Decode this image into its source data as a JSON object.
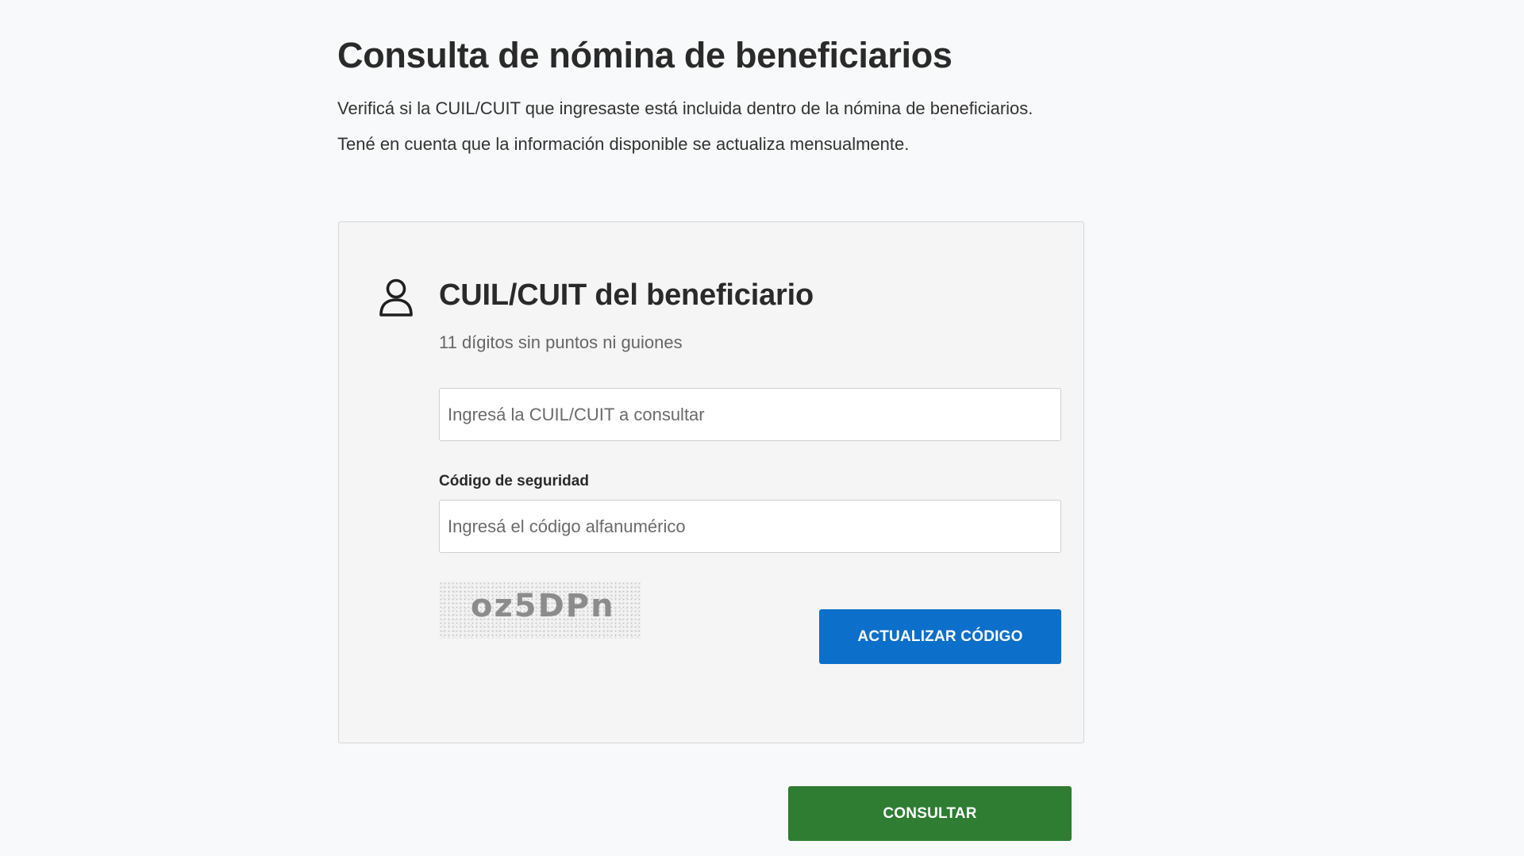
{
  "page": {
    "title": "Consulta de nómina de beneficiarios",
    "intro_line_1": "Verificá si la CUIL/CUIT que ingresaste está incluida dentro de la nómina de beneficiarios.",
    "intro_line_2": "Tené en cuenta que la información disponible se actualiza mensualmente."
  },
  "form": {
    "icon": "user-icon",
    "title": "CUIL/CUIT del beneficiario",
    "hint": "11 dígitos sin puntos ni guiones",
    "cuil_input": {
      "value": "",
      "placeholder": "Ingresá la CUIL/CUIT a consultar"
    },
    "security_label": "Código de seguridad",
    "code_input": {
      "value": "",
      "placeholder": "Ingresá el código alfanumérico"
    },
    "captcha_text": "oz5DPn",
    "refresh_button_label": "ACTUALIZAR CÓDIGO"
  },
  "submit_button_label": "CONSULTAR",
  "colors": {
    "primary_blue": "#0c6fc9",
    "submit_green": "#2e7d32",
    "card_background": "#f5f5f5",
    "page_background": "#f8f9fa"
  }
}
